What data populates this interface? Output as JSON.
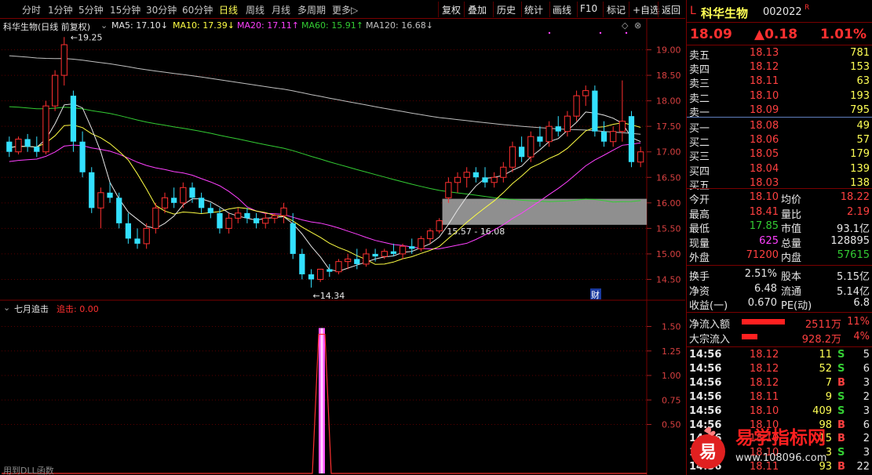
{
  "periods": [
    "分时",
    "1分钟",
    "5分钟",
    "15分钟",
    "30分钟",
    "60分钟",
    "日线",
    "周线",
    "月线",
    "多周期",
    "更多▷"
  ],
  "active_period": "日线",
  "tools": [
    "复权",
    "叠加",
    "历史",
    "统计",
    "画线",
    "F10",
    "标记",
    "+自选",
    "返回"
  ],
  "legend": {
    "title": "科华生物(日线 前复权)",
    "ma5": "MA5: 17.10↓",
    "ma10": "MA10: 17.39↓",
    "ma20": "MA20: 17.11↑",
    "ma60": "MA60: 15.91↑",
    "ma120": "MA120: 16.68↓"
  },
  "sub_legend": {
    "name": "七月追击",
    "series": "追击: 0.00"
  },
  "bottom_text": "用到DLL函数",
  "colors": {
    "up": "#ff3030",
    "down": "#33e0ff",
    "ma5": "#e6e6e6",
    "ma10": "#ffff44",
    "ma20": "#ff40ff",
    "ma60": "#33cc33",
    "ma120": "#c0c0c0",
    "box": "#a8a8a8",
    "signal": "#ff55ff"
  },
  "chart_data": [
    {
      "type": "candlestick",
      "title": "",
      "ylim": [
        14.2,
        19.3
      ],
      "yticks": [
        "19.00",
        "18.50",
        "18.00",
        "17.50",
        "17.00",
        "16.50",
        "16.00",
        "15.50",
        "15.00",
        "14.50"
      ],
      "ohlc": [
        [
          17.2,
          17.3,
          16.9,
          17.0
        ],
        [
          17.0,
          17.3,
          16.95,
          17.25
        ],
        [
          17.25,
          17.35,
          17.0,
          17.1
        ],
        [
          17.1,
          17.3,
          16.9,
          17.0
        ],
        [
          17.0,
          18.0,
          16.95,
          17.9
        ],
        [
          17.9,
          18.6,
          17.8,
          18.5
        ],
        [
          18.5,
          19.25,
          18.3,
          19.1
        ],
        [
          18.1,
          18.2,
          17.0,
          17.2
        ],
        [
          17.2,
          17.4,
          16.5,
          16.6
        ],
        [
          16.6,
          16.7,
          15.8,
          15.9
        ],
        [
          15.9,
          16.3,
          15.5,
          16.2
        ],
        [
          16.2,
          16.4,
          16.0,
          16.1
        ],
        [
          16.1,
          16.2,
          15.5,
          15.6
        ],
        [
          15.6,
          15.8,
          15.2,
          15.3
        ],
        [
          15.3,
          15.5,
          15.1,
          15.2
        ],
        [
          15.2,
          15.6,
          15.1,
          15.5
        ],
        [
          15.5,
          16.0,
          15.4,
          15.9
        ],
        [
          15.9,
          16.2,
          15.8,
          16.1
        ],
        [
          16.1,
          16.3,
          15.9,
          16.0
        ],
        [
          16.0,
          16.4,
          15.9,
          16.3
        ],
        [
          16.3,
          16.4,
          16.0,
          16.1
        ],
        [
          16.1,
          16.2,
          15.8,
          15.9
        ],
        [
          15.9,
          16.0,
          15.7,
          15.8
        ],
        [
          15.8,
          15.9,
          15.4,
          15.5
        ],
        [
          15.5,
          15.8,
          15.4,
          15.7
        ],
        [
          15.7,
          15.9,
          15.6,
          15.8
        ],
        [
          15.8,
          15.9,
          15.6,
          15.7
        ],
        [
          15.7,
          15.8,
          15.5,
          15.6
        ],
        [
          15.6,
          15.8,
          15.5,
          15.7
        ],
        [
          15.7,
          15.8,
          15.6,
          15.75
        ],
        [
          15.75,
          16.0,
          15.6,
          15.9
        ],
        [
          15.6,
          15.8,
          14.9,
          15.0
        ],
        [
          15.0,
          15.1,
          14.5,
          14.6
        ],
        [
          14.6,
          14.7,
          14.34,
          14.5
        ],
        [
          14.5,
          14.7,
          14.45,
          14.7
        ],
        [
          14.7,
          14.8,
          14.55,
          14.65
        ],
        [
          14.65,
          14.9,
          14.6,
          14.85
        ],
        [
          14.85,
          15.0,
          14.7,
          14.9
        ],
        [
          14.9,
          15.1,
          14.7,
          14.8
        ],
        [
          14.8,
          15.1,
          14.75,
          15.0
        ],
        [
          15.0,
          15.1,
          14.85,
          14.95
        ],
        [
          14.95,
          15.1,
          14.9,
          15.05
        ],
        [
          15.05,
          15.2,
          14.95,
          15.0
        ],
        [
          15.0,
          15.2,
          14.9,
          15.15
        ],
        [
          15.15,
          15.3,
          15.0,
          15.1
        ],
        [
          15.1,
          15.35,
          15.05,
          15.3
        ],
        [
          15.3,
          15.5,
          15.2,
          15.45
        ],
        [
          15.45,
          15.7,
          15.4,
          15.65
        ],
        [
          16.1,
          16.5,
          16.0,
          16.4
        ],
        [
          16.4,
          16.6,
          16.2,
          16.5
        ],
        [
          16.5,
          16.7,
          16.3,
          16.6
        ],
        [
          16.6,
          16.7,
          16.4,
          16.5
        ],
        [
          16.5,
          16.7,
          16.3,
          16.4
        ],
        [
          16.4,
          16.6,
          16.3,
          16.5
        ],
        [
          16.5,
          16.8,
          16.4,
          16.7
        ],
        [
          16.7,
          17.2,
          16.6,
          17.1
        ],
        [
          17.1,
          17.3,
          16.8,
          16.9
        ],
        [
          16.9,
          17.4,
          16.8,
          17.3
        ],
        [
          17.3,
          17.5,
          17.1,
          17.2
        ],
        [
          17.2,
          17.6,
          17.1,
          17.5
        ],
        [
          17.5,
          17.7,
          17.3,
          17.4
        ],
        [
          17.4,
          17.8,
          17.3,
          17.7
        ],
        [
          17.7,
          18.2,
          17.6,
          18.1
        ],
        [
          18.1,
          18.3,
          17.9,
          18.2
        ],
        [
          18.2,
          18.3,
          17.3,
          17.4
        ],
        [
          17.4,
          17.6,
          17.1,
          17.2
        ],
        [
          17.2,
          17.5,
          17.1,
          17.4
        ],
        [
          17.4,
          18.4,
          17.2,
          17.6
        ],
        [
          17.7,
          17.8,
          16.7,
          16.8
        ],
        [
          16.8,
          17.1,
          16.7,
          17.0
        ]
      ],
      "annotations": {
        "high": "19.25",
        "low": "14.34",
        "box_label": "15.57 - 16.08",
        "box_range": [
          15.57,
          16.08
        ],
        "marker": "财"
      }
    },
    {
      "type": "line",
      "title": "七月追击",
      "ylim": [
        0,
        1.6
      ],
      "yticks": [
        "1.50",
        "1.25",
        "1.00",
        "0.75",
        "0.50"
      ],
      "signal_index": 52,
      "signal_value": 1.5
    }
  ],
  "stock": {
    "prefix": "L",
    "name": "科华生物",
    "code": "002022",
    "flag": "R",
    "price": "18.09",
    "change": "▲0.18",
    "pct": "1.01%"
  },
  "order_book": [
    {
      "label": "卖五",
      "price": "18.13",
      "vol": "781"
    },
    {
      "label": "卖四",
      "price": "18.12",
      "vol": "153"
    },
    {
      "label": "卖三",
      "price": "18.11",
      "vol": "63"
    },
    {
      "label": "卖二",
      "price": "18.10",
      "vol": "193"
    },
    {
      "label": "卖一",
      "price": "18.09",
      "vol": "795"
    },
    {
      "label": "买一",
      "price": "18.08",
      "vol": "49"
    },
    {
      "label": "买二",
      "price": "18.06",
      "vol": "57"
    },
    {
      "label": "买三",
      "price": "18.05",
      "vol": "179"
    },
    {
      "label": "买四",
      "price": "18.04",
      "vol": "139"
    },
    {
      "label": "买五",
      "price": "18.03",
      "vol": "138"
    }
  ],
  "stats": [
    {
      "l1": "今开",
      "v1": "18.10",
      "l2": "均价",
      "v2": "18.22"
    },
    {
      "l1": "最高",
      "v1": "18.41",
      "l2": "量比",
      "v2": "2.19"
    },
    {
      "l1": "最低",
      "v1": "17.85",
      "l2": "市值",
      "v2": "93.1亿"
    },
    {
      "l1": "现量",
      "v1": "625",
      "l2": "总量",
      "v2": "128895"
    },
    {
      "l1": "外盘",
      "v1": "71200",
      "l2": "内盘",
      "v2": "57615"
    }
  ],
  "stats2": [
    {
      "l1": "换手",
      "v1": "2.51%",
      "l2": "股本",
      "v2": "5.15亿"
    },
    {
      "l1": "净资",
      "v1": "6.48",
      "l2": "流通",
      "v2": "5.14亿"
    },
    {
      "l1": "收益(一)",
      "v1": "0.670",
      "l2": "PE(动)",
      "v2": "6.8"
    }
  ],
  "flows": [
    {
      "label": "净流入额",
      "value": "2511万",
      "pct": "11%"
    },
    {
      "label": "大宗流入",
      "value": "928.2万",
      "pct": "4%"
    }
  ],
  "ticks": [
    {
      "time": "14:56",
      "price": "18.12",
      "vol": "11",
      "bs": "S",
      "n": "5"
    },
    {
      "time": "14:56",
      "price": "18.12",
      "vol": "52",
      "bs": "S",
      "n": "6"
    },
    {
      "time": "14:56",
      "price": "18.12",
      "vol": "7",
      "bs": "B",
      "n": "3"
    },
    {
      "time": "14:56",
      "price": "18.11",
      "vol": "9",
      "bs": "S",
      "n": "2"
    },
    {
      "time": "14:56",
      "price": "18.10",
      "vol": "409",
      "bs": "S",
      "n": "3"
    },
    {
      "time": "14:56",
      "price": "18.10",
      "vol": "98",
      "bs": "B",
      "n": "6"
    },
    {
      "time": "14:56",
      "price": "18.10",
      "vol": "15",
      "bs": "B",
      "n": "2"
    },
    {
      "time": "14:56",
      "price": "18.10",
      "vol": "3",
      "bs": "S",
      "n": "3"
    },
    {
      "time": "14:56",
      "price": "18.11",
      "vol": "93",
      "bs": "B",
      "n": "22"
    }
  ],
  "watermark": {
    "icon": "易",
    "text": "易学指标网",
    "url": "www.108096.com"
  }
}
